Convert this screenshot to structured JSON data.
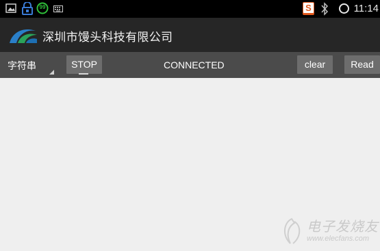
{
  "status_bar": {
    "battery_level": "99",
    "time": "11:14",
    "icons": [
      "image-icon",
      "lock-icon",
      "battery-icon",
      "keyboard-icon",
      "sogou-icon",
      "bluetooth-icon",
      "sync-icon"
    ]
  },
  "app": {
    "title": "深圳市馒头科技有限公司"
  },
  "toolbar": {
    "mode_label": "字符串",
    "stop_label": "STOP",
    "status_text": "CONNECTED",
    "clear_label": "clear",
    "read_label": "Read"
  },
  "watermark": {
    "text": "电子发烧友",
    "url": "www.elecfans.com"
  },
  "colors": {
    "status_bar": "#000000",
    "app_bar": "#262626",
    "toolbar": "#4b4b4b",
    "button": "#6d6d6d",
    "content": "#efefef",
    "sogou": "#e2581c"
  }
}
